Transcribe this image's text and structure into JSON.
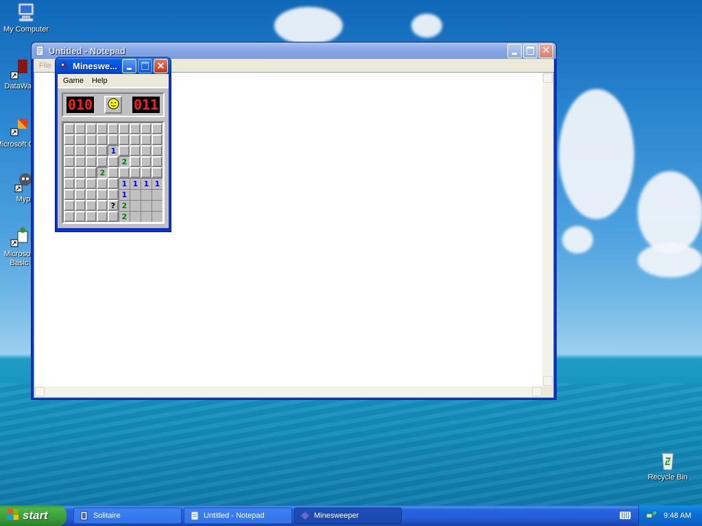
{
  "desktop": {
    "icons": [
      {
        "label": "My Computer",
        "icon": "my-computer-icon"
      },
      {
        "label": "DataWar",
        "icon": "datawar-shortcut-icon"
      },
      {
        "label": "Microsoft C++",
        "icon": "microsoft-cpp-shortcut-icon"
      },
      {
        "label": "Myp",
        "icon": "myp-shortcut-icon"
      },
      {
        "label": "Microsoft Basic",
        "icon": "microsoft-basic-shortcut-icon"
      },
      {
        "label": "Recycle Bin",
        "icon": "recycle-bin-icon"
      }
    ]
  },
  "notepad": {
    "title": "Untitled - Notepad",
    "menu": [
      "File"
    ],
    "text": ""
  },
  "minesweeper": {
    "title": "Mineswe...",
    "menu": [
      "Game",
      "Help"
    ],
    "mines_left": "010",
    "timer": "011",
    "face": "smiley",
    "grid": [
      [
        "c",
        "c",
        "c",
        "c",
        "c",
        "c",
        "c",
        "c",
        "c"
      ],
      [
        "c",
        "c",
        "c",
        "c",
        "c",
        "c",
        "c",
        "c",
        "c"
      ],
      [
        "c",
        "c",
        "c",
        "c",
        "1",
        "c",
        "c",
        "c",
        "c"
      ],
      [
        "c",
        "c",
        "c",
        "c",
        "c",
        "2",
        "c",
        "c",
        "c"
      ],
      [
        "c",
        "c",
        "c",
        "2",
        "c",
        "c",
        "c",
        "c",
        "c"
      ],
      [
        "c",
        "c",
        "c",
        "c",
        "c",
        "1",
        "1",
        "1",
        "1"
      ],
      [
        "c",
        "c",
        "c",
        "c",
        "c",
        "1",
        "o",
        "o",
        "o"
      ],
      [
        "c",
        "c",
        "c",
        "c",
        "?",
        "2",
        "o",
        "o",
        "o"
      ],
      [
        "c",
        "c",
        "c",
        "c",
        "c",
        "2",
        "o",
        "o",
        "o"
      ]
    ]
  },
  "taskbar": {
    "start_label": "start",
    "tasks": [
      {
        "label": "Solitaire",
        "icon": "solitaire-icon",
        "active": false
      },
      {
        "label": "Untitled - Notepad",
        "icon": "notepad-icon",
        "active": false
      },
      {
        "label": "Minesweeper",
        "icon": "minesweeper-icon",
        "active": true
      }
    ],
    "clock": "9:48 AM"
  }
}
